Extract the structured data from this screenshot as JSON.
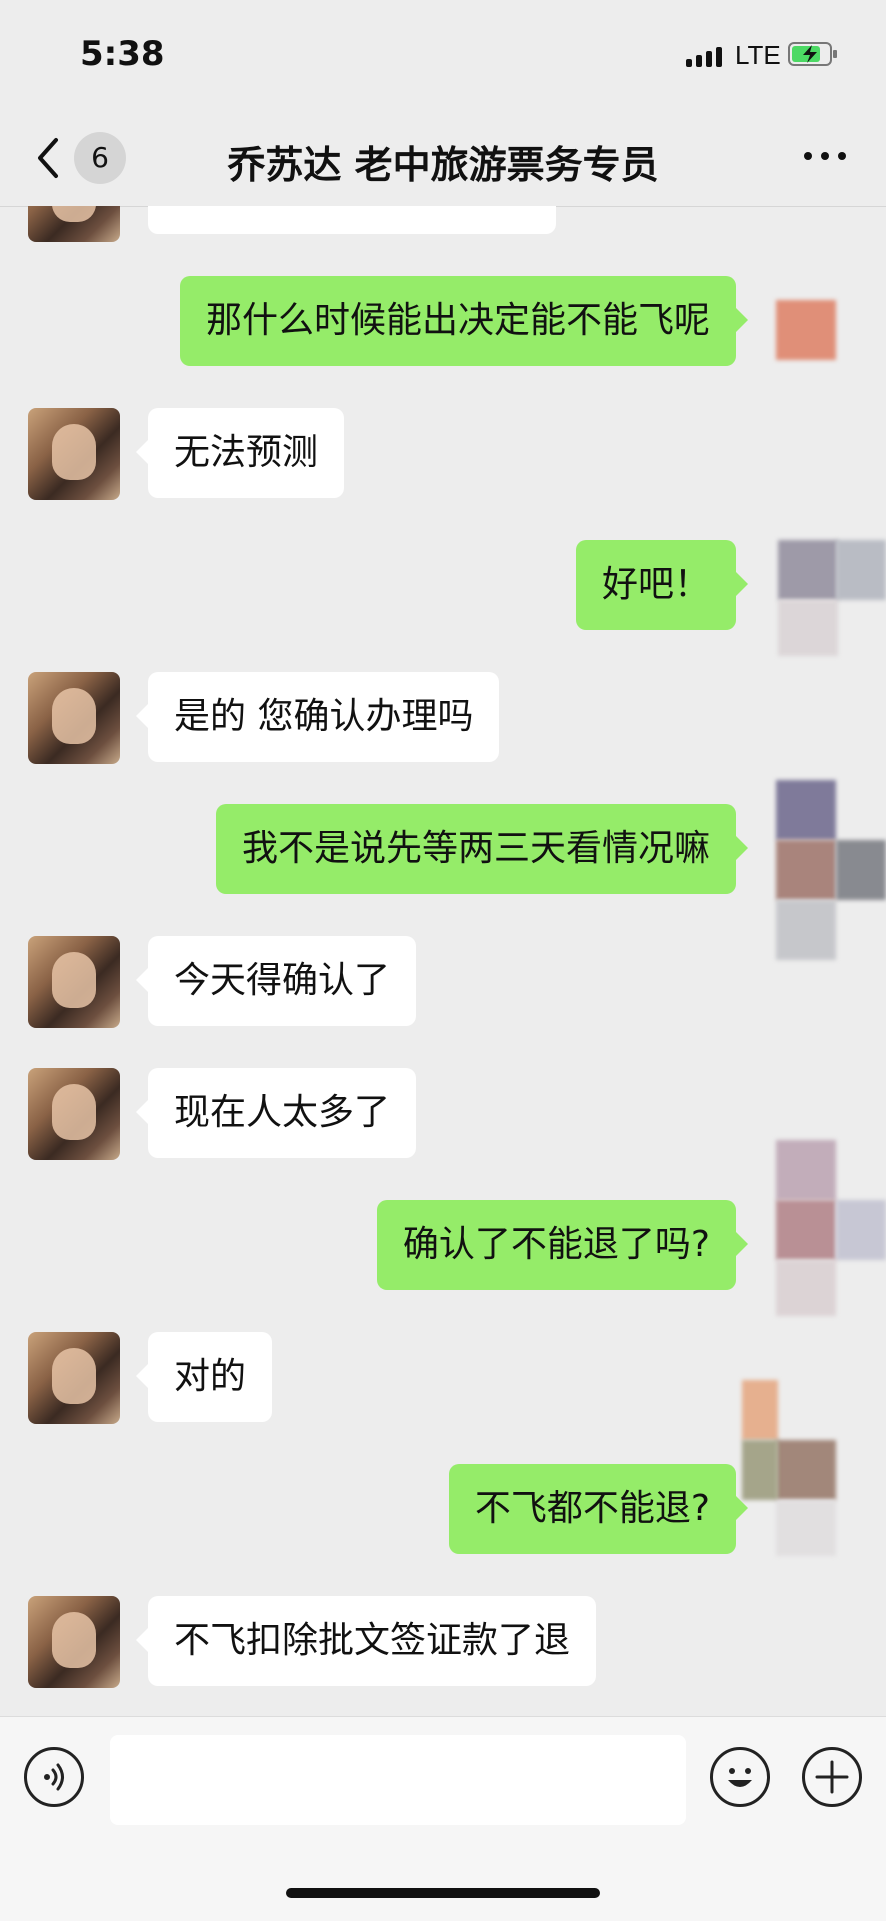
{
  "status": {
    "time": "5:38",
    "network": "LTE"
  },
  "nav": {
    "unread": "6",
    "title": "乔苏达 老中旅游票务专员"
  },
  "messages": [
    {
      "side": "out",
      "text": "那什么时候能出决定能不能飞呢"
    },
    {
      "side": "in",
      "text": "无法预测"
    },
    {
      "side": "out",
      "text": "好吧！"
    },
    {
      "side": "in",
      "text": "是的 您确认办理吗"
    },
    {
      "side": "out",
      "text": "我不是说先等两三天看情况嘛"
    },
    {
      "side": "in",
      "text": "今天得确认了"
    },
    {
      "side": "in",
      "text": "现在人太多了"
    },
    {
      "side": "out",
      "text": "确认了不能退了吗?"
    },
    {
      "side": "in",
      "text": "对的"
    },
    {
      "side": "out",
      "text": "不飞都不能退?"
    },
    {
      "side": "in",
      "text": "不飞扣除批文签证款了退"
    }
  ],
  "icons": {
    "back": "chevron-left-icon",
    "more": "more-dots-icon",
    "voice": "voice-icon",
    "emoji": "emoji-icon",
    "plus": "plus-icon"
  },
  "colors": {
    "outgoing_bubble": "#95ec69",
    "incoming_bubble": "#ffffff",
    "background": "#ededed"
  }
}
